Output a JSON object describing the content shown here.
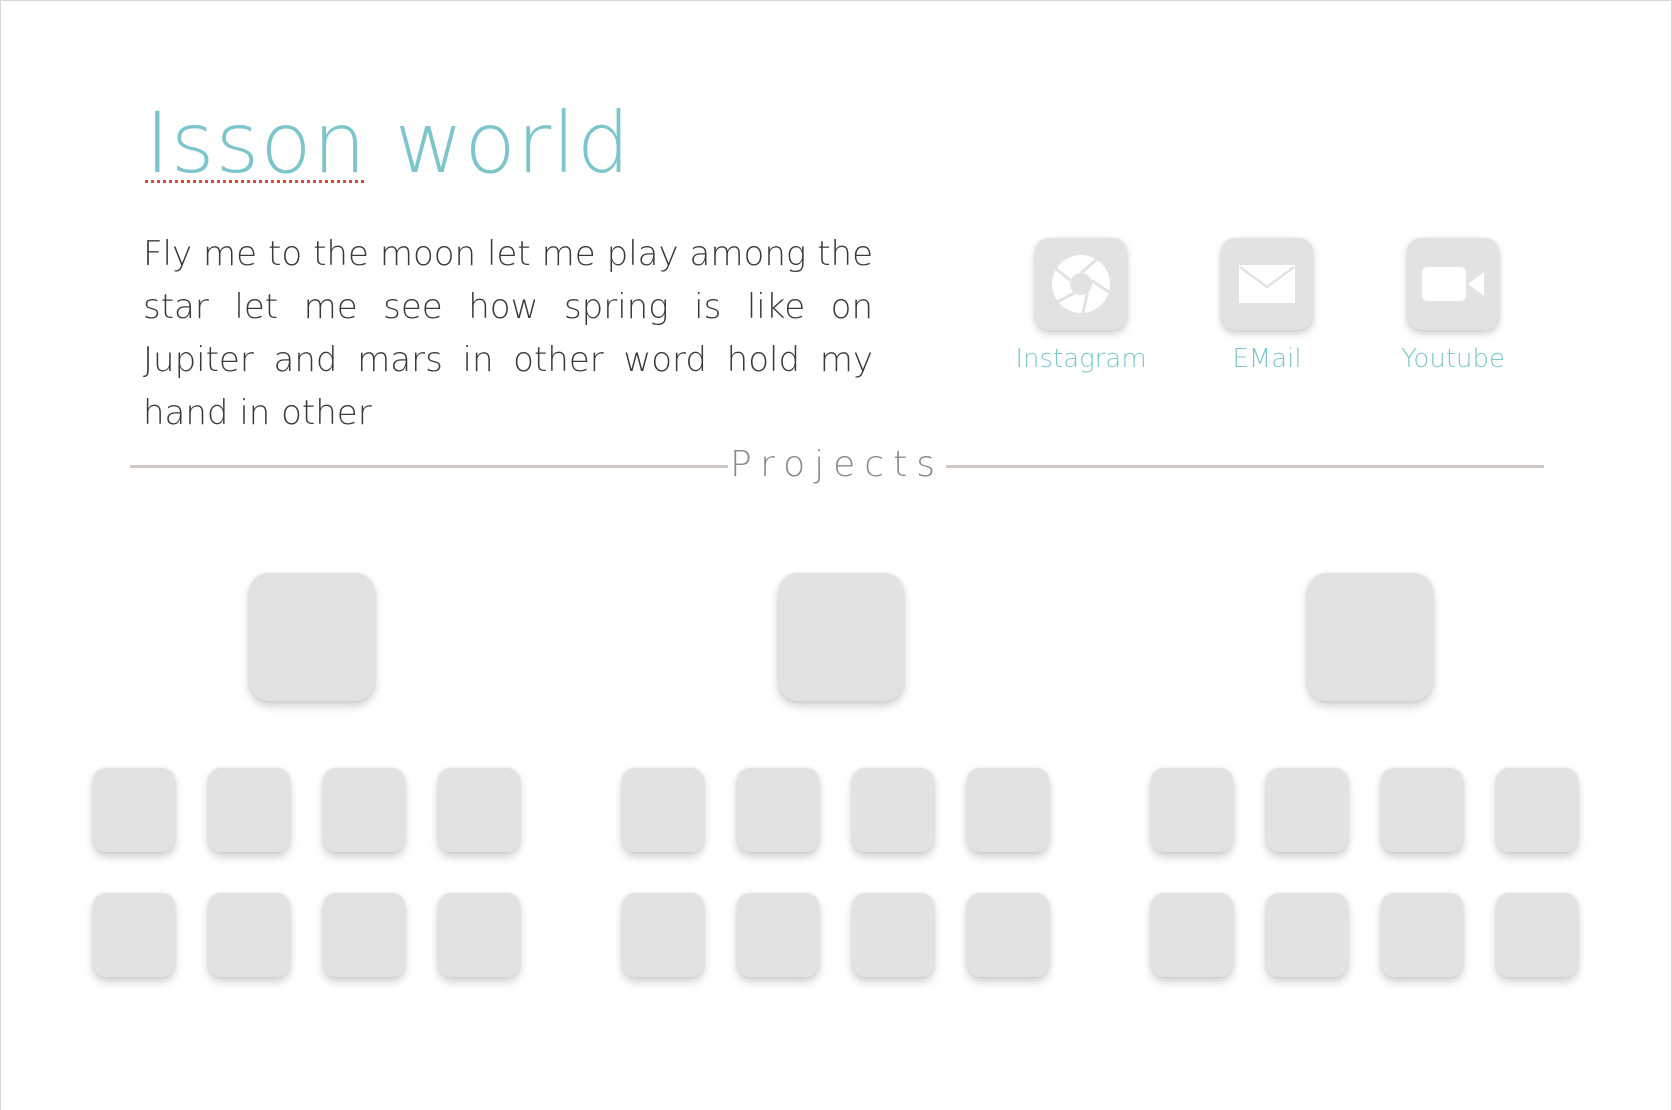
{
  "header": {
    "title_first": "Isson",
    "title_second": "world",
    "intro": "Fly me to the moon let me play among the star let me see how spring is like on Jupiter and mars in other word hold my hand in other"
  },
  "socials": [
    {
      "label": "Instagram",
      "icon": "camera-shutter-icon"
    },
    {
      "label": "EMail",
      "icon": "envelope-icon"
    },
    {
      "label": "Youtube",
      "icon": "video-camera-icon"
    }
  ],
  "projects": {
    "heading": "Projects",
    "groups": [
      {
        "featured_count": 1,
        "item_count": 8
      },
      {
        "featured_count": 1,
        "item_count": 8
      },
      {
        "featured_count": 1,
        "item_count": 8
      }
    ]
  },
  "colors": {
    "accent": "#7cc6cb",
    "text": "#3a3a3a",
    "tile": "#e2e2e2",
    "divider": "#cfc8c2",
    "spellcheck": "#e0443a"
  }
}
